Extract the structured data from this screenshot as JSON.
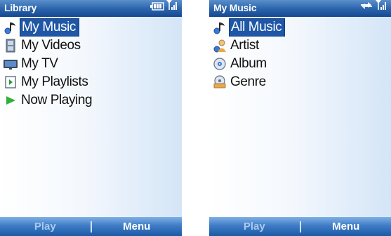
{
  "screens": [
    {
      "title": "Library",
      "status_icons": [
        "battery-icon",
        "signal-icon"
      ],
      "items": [
        {
          "label": "My Music",
          "icon": "music-note-icon",
          "selected": true
        },
        {
          "label": "My Videos",
          "icon": "video-film-icon",
          "selected": false
        },
        {
          "label": "My TV",
          "icon": "tv-icon",
          "selected": false
        },
        {
          "label": "My Playlists",
          "icon": "playlist-icon",
          "selected": false
        },
        {
          "label": "Now Playing",
          "icon": "play-arrow-icon",
          "selected": false
        }
      ],
      "softkeys": {
        "left": "Play",
        "right": "Menu"
      }
    },
    {
      "title": "My Music",
      "status_icons": [
        "sync-arrows-icon",
        "signal-icon"
      ],
      "items": [
        {
          "label": "All Music",
          "icon": "music-note-icon",
          "selected": true
        },
        {
          "label": "Artist",
          "icon": "artist-icon",
          "selected": false
        },
        {
          "label": "Album",
          "icon": "album-disc-icon",
          "selected": false
        },
        {
          "label": "Genre",
          "icon": "genre-icon",
          "selected": false
        }
      ],
      "softkeys": {
        "left": "Play",
        "right": "Menu"
      }
    }
  ],
  "colors": {
    "titlebar": "#2d66ad",
    "selection": "#1f57a6",
    "softbar": "#3f7cc6"
  }
}
